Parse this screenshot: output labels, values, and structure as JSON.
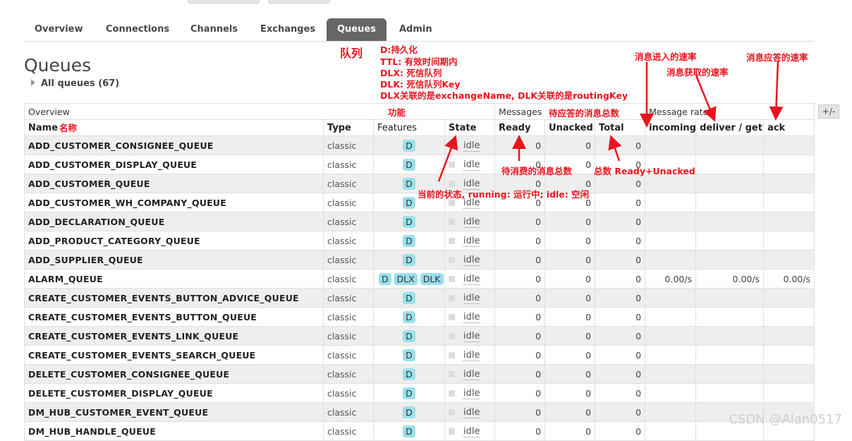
{
  "nav": {
    "tabs": [
      {
        "label": "Overview"
      },
      {
        "label": "Connections"
      },
      {
        "label": "Channels"
      },
      {
        "label": "Exchanges"
      },
      {
        "label": "Queues",
        "active": true
      },
      {
        "label": "Admin"
      }
    ]
  },
  "page": {
    "title": "Queues",
    "all_queues": "All queues (67)",
    "plus_minus": "+/-"
  },
  "table": {
    "group_headers": {
      "overview": "Overview",
      "messages": "Messages",
      "message_rates": "Message rates"
    },
    "columns": [
      "Name",
      "Type",
      "Features",
      "State",
      "Ready",
      "Unacked",
      "Total",
      "incoming",
      "deliver / get",
      "ack"
    ],
    "rows": [
      {
        "name": "ADD_CUSTOMER_CONSIGNEE_QUEUE",
        "type": "classic",
        "features": [
          "D"
        ],
        "state": "idle",
        "ready": "0",
        "unacked": "0",
        "total": "0",
        "incoming": "",
        "deliver": "",
        "ack": ""
      },
      {
        "name": "ADD_CUSTOMER_DISPLAY_QUEUE",
        "type": "classic",
        "features": [
          "D"
        ],
        "state": "idle",
        "ready": "0",
        "unacked": "0",
        "total": "0",
        "incoming": "",
        "deliver": "",
        "ack": ""
      },
      {
        "name": "ADD_CUSTOMER_QUEUE",
        "type": "classic",
        "features": [
          "D"
        ],
        "state": "idle",
        "ready": "0",
        "unacked": "0",
        "total": "0",
        "incoming": "",
        "deliver": "",
        "ack": ""
      },
      {
        "name": "ADD_CUSTOMER_WH_COMPANY_QUEUE",
        "type": "classic",
        "features": [
          "D"
        ],
        "state": "idle",
        "ready": "0",
        "unacked": "0",
        "total": "0",
        "incoming": "",
        "deliver": "",
        "ack": ""
      },
      {
        "name": "ADD_DECLARATION_QUEUE",
        "type": "classic",
        "features": [
          "D"
        ],
        "state": "idle",
        "ready": "0",
        "unacked": "0",
        "total": "0",
        "incoming": "",
        "deliver": "",
        "ack": ""
      },
      {
        "name": "ADD_PRODUCT_CATEGORY_QUEUE",
        "type": "classic",
        "features": [
          "D"
        ],
        "state": "idle",
        "ready": "0",
        "unacked": "0",
        "total": "0",
        "incoming": "",
        "deliver": "",
        "ack": ""
      },
      {
        "name": "ADD_SUPPLIER_QUEUE",
        "type": "classic",
        "features": [
          "D"
        ],
        "state": "idle",
        "ready": "0",
        "unacked": "0",
        "total": "0",
        "incoming": "",
        "deliver": "",
        "ack": ""
      },
      {
        "name": "ALARM_QUEUE",
        "type": "classic",
        "features": [
          "D",
          "DLX",
          "DLK"
        ],
        "state": "idle",
        "ready": "0",
        "unacked": "0",
        "total": "0",
        "incoming": "0.00/s",
        "deliver": "0.00/s",
        "ack": "0.00/s"
      },
      {
        "name": "CREATE_CUSTOMER_EVENTS_BUTTON_ADVICE_QUEUE",
        "type": "classic",
        "features": [
          "D"
        ],
        "state": "idle",
        "ready": "0",
        "unacked": "0",
        "total": "0",
        "incoming": "",
        "deliver": "",
        "ack": ""
      },
      {
        "name": "CREATE_CUSTOMER_EVENTS_BUTTON_QUEUE",
        "type": "classic",
        "features": [
          "D"
        ],
        "state": "idle",
        "ready": "0",
        "unacked": "0",
        "total": "0",
        "incoming": "",
        "deliver": "",
        "ack": ""
      },
      {
        "name": "CREATE_CUSTOMER_EVENTS_LINK_QUEUE",
        "type": "classic",
        "features": [
          "D"
        ],
        "state": "idle",
        "ready": "0",
        "unacked": "0",
        "total": "0",
        "incoming": "",
        "deliver": "",
        "ack": ""
      },
      {
        "name": "CREATE_CUSTOMER_EVENTS_SEARCH_QUEUE",
        "type": "classic",
        "features": [
          "D"
        ],
        "state": "idle",
        "ready": "0",
        "unacked": "0",
        "total": "0",
        "incoming": "",
        "deliver": "",
        "ack": ""
      },
      {
        "name": "DELETE_CUSTOMER_CONSIGNEE_QUEUE",
        "type": "classic",
        "features": [
          "D"
        ],
        "state": "idle",
        "ready": "0",
        "unacked": "0",
        "total": "0",
        "incoming": "",
        "deliver": "",
        "ack": ""
      },
      {
        "name": "DELETE_CUSTOMER_DISPLAY_QUEUE",
        "type": "classic",
        "features": [
          "D"
        ],
        "state": "idle",
        "ready": "0",
        "unacked": "0",
        "total": "0",
        "incoming": "",
        "deliver": "",
        "ack": ""
      },
      {
        "name": "DM_HUB_CUSTOMER_EVENT_QUEUE",
        "type": "classic",
        "features": [
          "D"
        ],
        "state": "idle",
        "ready": "0",
        "unacked": "0",
        "total": "0",
        "incoming": "",
        "deliver": "",
        "ack": ""
      },
      {
        "name": "DM_HUB_HANDLE_QUEUE",
        "type": "classic",
        "features": [
          "D"
        ],
        "state": "idle",
        "ready": "0",
        "unacked": "0",
        "total": "0",
        "incoming": "",
        "deliver": "",
        "ack": ""
      }
    ]
  },
  "annotations": {
    "queue": "队列",
    "d": "D:持久化",
    "ttl": "TTL:  有效时间期内",
    "dlx": "DLX:  死信队列",
    "dlk": "DLK:  死信队列Key",
    "dlx_note": "DLX关联的是exchangeName, DLK关联的是routingKey",
    "function": "功能",
    "name": "名称",
    "incoming_rate": "消息进入的速率",
    "fetch_rate": "消息获取的速率",
    "ack_rate": "消息应答的速率",
    "unacked_total": "待应答的消息总数",
    "ready_total": "待消费的消息总数",
    "total_note": "总数 Ready+Unacked",
    "state_note": "当前的状态, running: 运行中; idle: 空闲",
    "color": "#e8141e"
  },
  "watermark": "CSDN @Alan0517"
}
